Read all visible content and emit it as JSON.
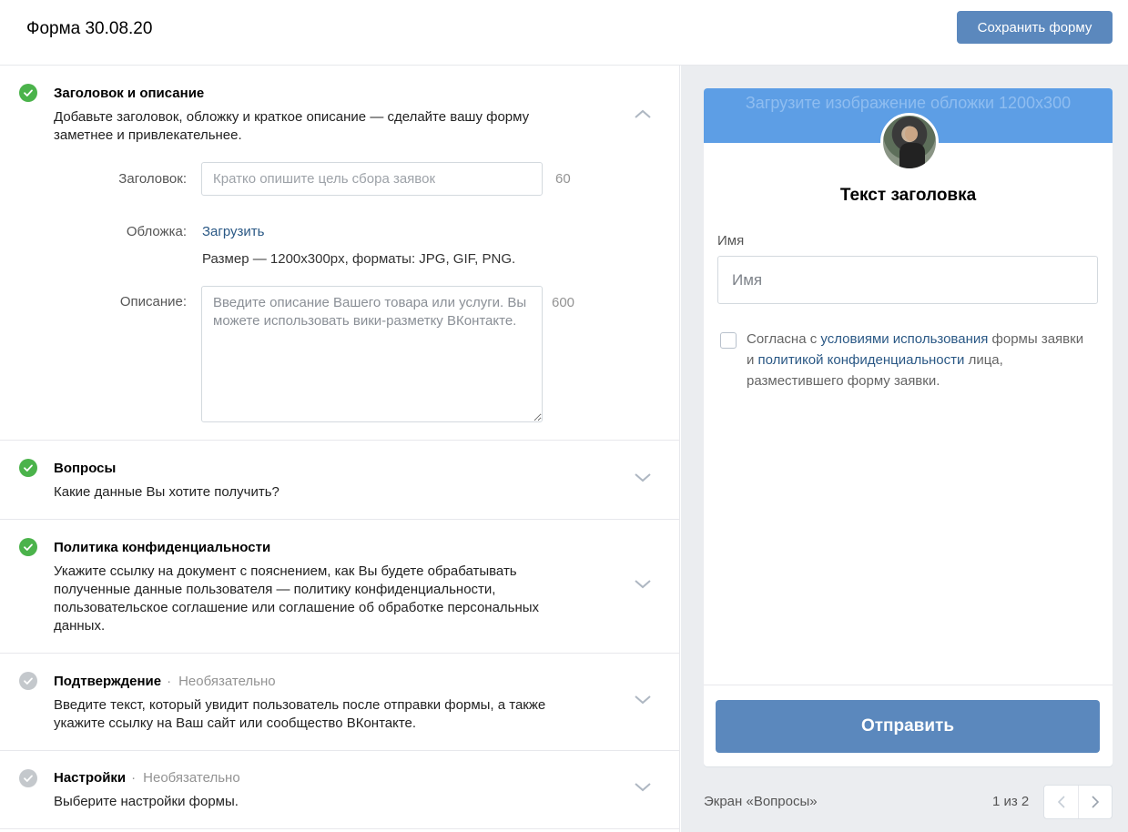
{
  "header": {
    "title": "Форма 30.08.20",
    "save_label": "Сохранить форму"
  },
  "sections": [
    {
      "title": "Заголовок и описание",
      "optional": "",
      "status": "done",
      "expanded": true,
      "description": "Добавьте заголовок, обложку и краткое описание — сделайте вашу форму заметнее и привлекательнее."
    },
    {
      "title": "Вопросы",
      "optional": "",
      "status": "done",
      "expanded": false,
      "description": "Какие данные Вы хотите получить?"
    },
    {
      "title": "Политика конфиденциальности",
      "optional": "",
      "status": "done",
      "expanded": false,
      "description": "Укажите ссылку на документ с пояснением, как Вы будете обрабатывать полученные данные пользователя — политику конфиденциальности, пользовательское соглашение или соглашение об обработке персональных данных."
    },
    {
      "title": "Подтверждение",
      "optional": "Необязательно",
      "status": "todo",
      "expanded": false,
      "description": "Введите текст, который увидит пользователь после отправки формы, а также укажите ссылку на Ваш сайт или сообщество ВКонтакте."
    },
    {
      "title": "Настройки",
      "optional": "Необязательно",
      "status": "todo",
      "expanded": false,
      "description": "Выберите настройки формы."
    }
  ],
  "editor": {
    "title_label": "Заголовок:",
    "title_placeholder": "Кратко опишите цель сбора заявок",
    "title_value": "",
    "title_limit": "60",
    "cover_label": "Обложка:",
    "cover_upload": "Загрузить",
    "cover_hint": "Размер — 1200x300px, форматы: JPG, GIF, PNG.",
    "desc_label": "Описание:",
    "desc_placeholder": "Введите описание Вашего товара или услуги. Вы можете использовать вики-разметку ВКонтакте.",
    "desc_value": "",
    "desc_limit": "600"
  },
  "preview": {
    "cover_text": "Загрузите изображение обложки 1200x300",
    "heading": "Текст заголовка",
    "field_label": "Имя",
    "field_placeholder": "Имя",
    "consent_1": "Согласна с ",
    "consent_link_1": "условиями использования",
    "consent_2": " формы заявки и ",
    "consent_link_2": "политикой конфиденциальности",
    "consent_3": " лица, разместившего форму заявки.",
    "consent_checked": false,
    "submit_label": "Отправить",
    "screen_label": "Экран «Вопросы»",
    "page_counter": "1 из 2"
  },
  "colors": {
    "accent": "#5b88bd",
    "link": "#2a5885",
    "done": "#4bb34b",
    "todo": "#c4c8cc",
    "cover": "#5d9ee5",
    "panel": "#ebedf0"
  },
  "icons": {
    "status": "check-circle-icon",
    "expand": "chevron-down-icon",
    "collapse": "chevron-up-icon",
    "prev": "chevron-left-icon",
    "next": "chevron-right-icon"
  }
}
